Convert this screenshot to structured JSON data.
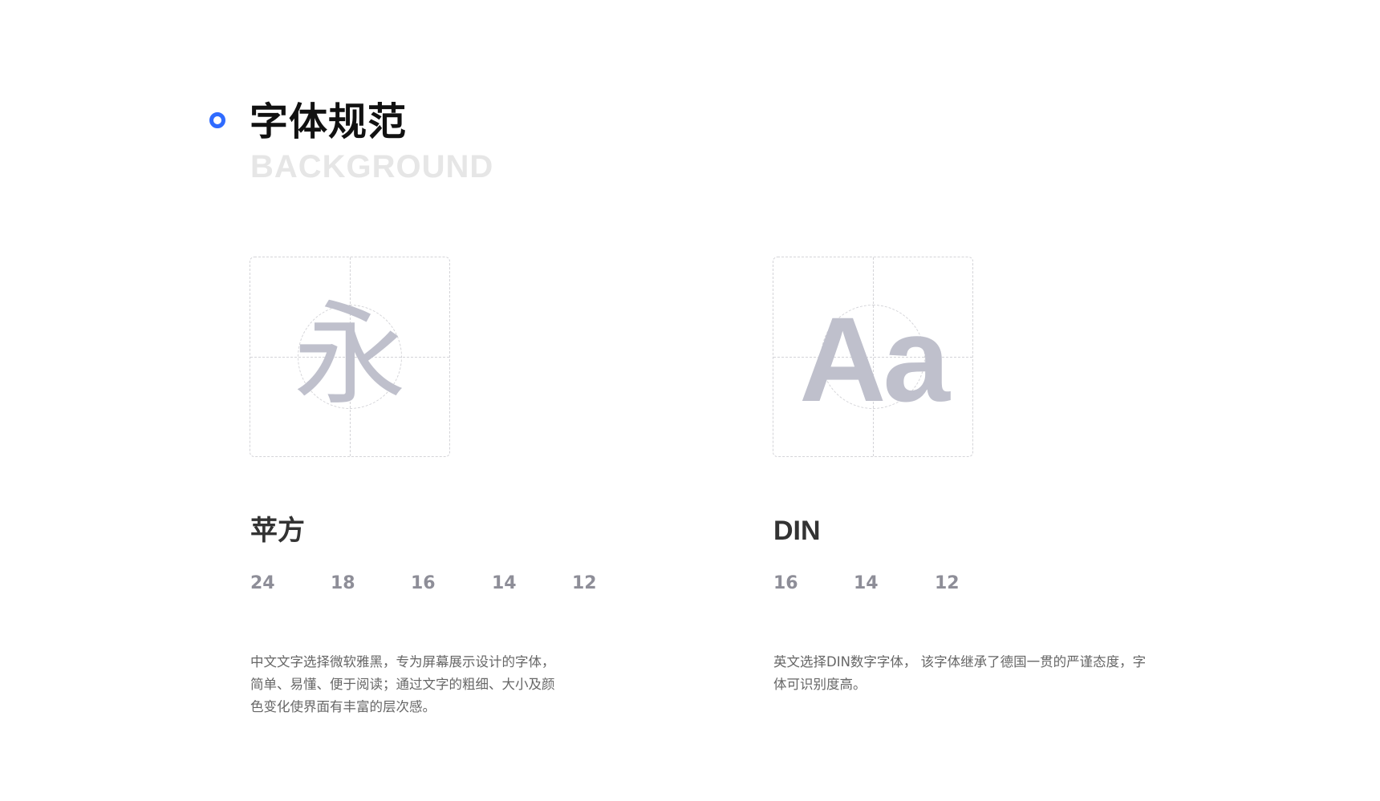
{
  "header": {
    "title": "字体规范",
    "subtitle": "BACKGROUND",
    "accent_color": "#2f6bff"
  },
  "columns": [
    {
      "specimen_glyph": "永",
      "font_name": "苹方",
      "sizes": [
        "24",
        "18",
        "16",
        "14",
        "12"
      ],
      "description": [
        "中文文字选择微软雅黑，专为屏幕展示设计的字体，",
        "简单、易懂、便于阅读；通过文字的粗细、大小及颜",
        "色变化使界面有丰富的层次感。"
      ]
    },
    {
      "specimen_glyph": "Aa",
      "font_name": "DIN",
      "sizes": [
        "16",
        "14",
        "12"
      ],
      "description": [
        "英文选择DIN数字字体， 该字体继承了德国一贯的严谨态度，字",
        "体可识别度高。"
      ]
    }
  ]
}
